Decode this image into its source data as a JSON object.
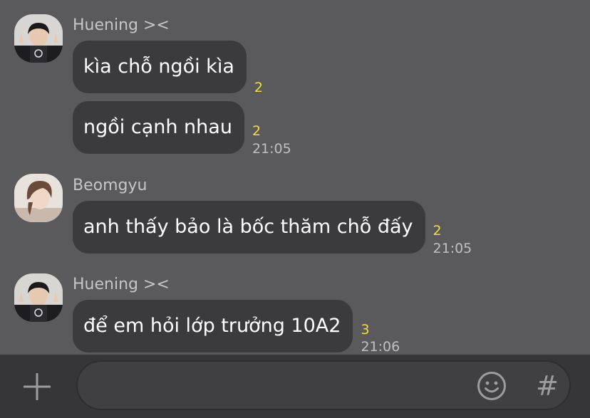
{
  "messages": [
    {
      "sender": "Huening ><",
      "avatar": "avatar-huening",
      "bubbles": [
        {
          "text": "kìa chỗ ngồi kìa",
          "unread": "2",
          "time": ""
        },
        {
          "text": "ngồi cạnh nhau",
          "unread": "2",
          "time": "21:05"
        }
      ]
    },
    {
      "sender": "Beomgyu",
      "avatar": "avatar-beomgyu",
      "bubbles": [
        {
          "text": "anh thấy bảo là bốc thăm chỗ đấy",
          "unread": "2",
          "time": "21:05"
        }
      ]
    },
    {
      "sender": "Huening ><",
      "avatar": "avatar-huening",
      "bubbles": [
        {
          "text": "để em hỏi lớp trưởng 10A2",
          "unread": "3",
          "time": "21:06"
        }
      ]
    }
  ],
  "composer": {
    "input_value": "",
    "plus_icon": "plus-icon",
    "emoji_icon": "emoji-icon",
    "hash_label": "#"
  },
  "colors": {
    "background": "#5a595b",
    "bubble": "#3b3a3c",
    "unread": "#f7dc3c",
    "composer_bar": "#363537"
  }
}
